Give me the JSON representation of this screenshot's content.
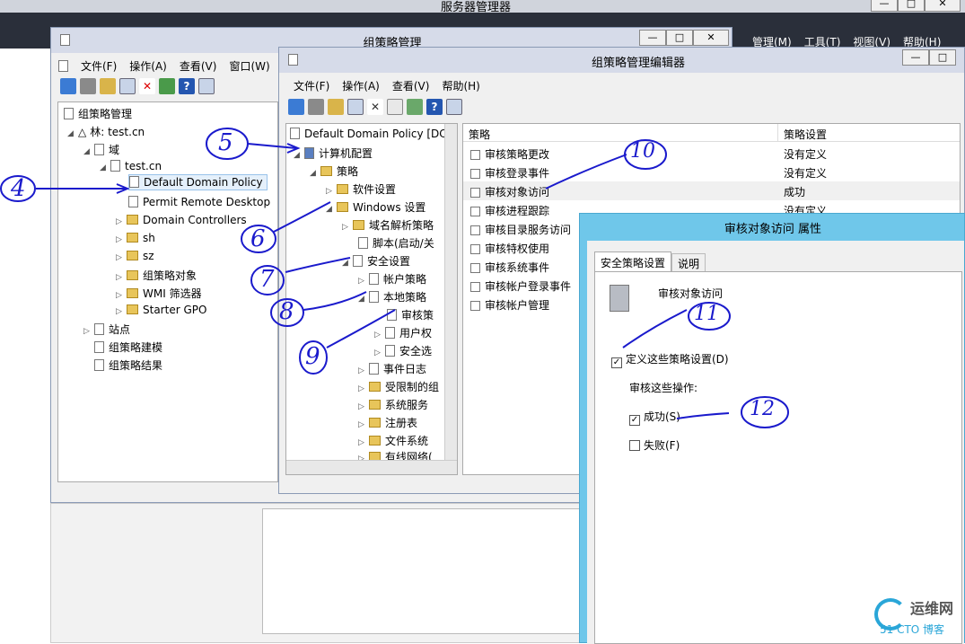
{
  "server_manager": {
    "title": "服务器管理器",
    "menu": [
      "管理(M)",
      "工具(T)",
      "视图(V)",
      "帮助(H)"
    ]
  },
  "gpm": {
    "title": "组策略管理",
    "menu": [
      "文件(F)",
      "操作(A)",
      "查看(V)",
      "窗口(W)"
    ],
    "tree": {
      "root": "组策略管理",
      "forest": "林: test.cn",
      "domains": "域",
      "domain": "test.cn",
      "items": [
        "Default Domain Policy",
        "Permit Remote Desktop",
        "Domain Controllers",
        "sh",
        "sz",
        "组策略对象",
        "WMI 筛选器",
        "Starter GPO"
      ],
      "sites": "站点",
      "modeling": "组策略建模",
      "results": "组策略结果"
    }
  },
  "gpme": {
    "title": "组策略管理编辑器",
    "menu": [
      "文件(F)",
      "操作(A)",
      "查看(V)",
      "帮助(H)"
    ],
    "tree": {
      "root": "Default Domain Policy [DC",
      "computer_config": "计算机配置",
      "policies": "策略",
      "software": "软件设置",
      "windows": "Windows 设置",
      "dns": "域名解析策略",
      "scripts": "脚本(启动/关",
      "security": "安全设置",
      "account": "帐户策略",
      "local": "本地策略",
      "audit": "审核策",
      "user_rights": "用户权",
      "security_options": "安全选",
      "event_log": "事件日志",
      "restricted": "受限制的组",
      "system_services": "系统服务",
      "registry": "注册表",
      "filesystem": "文件系统",
      "wired": "有线网络("
    },
    "list": {
      "col_policy": "策略",
      "col_setting": "策略设置",
      "rows": [
        {
          "name": "审核策略更改",
          "value": "没有定义"
        },
        {
          "name": "审核登录事件",
          "value": "没有定义"
        },
        {
          "name": "审核对象访问",
          "value": "成功"
        },
        {
          "name": "审核进程跟踪",
          "value": "没有定义"
        },
        {
          "name": "审核目录服务访问",
          "value": ""
        },
        {
          "name": "审核特权使用",
          "value": ""
        },
        {
          "name": "审核系统事件",
          "value": ""
        },
        {
          "name": "审核帐户登录事件",
          "value": ""
        },
        {
          "name": "审核帐户管理",
          "value": ""
        }
      ]
    }
  },
  "props": {
    "title": "审核对象访问 属性",
    "tabs": [
      "安全策略设置",
      "说明"
    ],
    "policy_name": "审核对象访问",
    "define_label": "定义这些策略设置(D)",
    "audit_label": "审核这些操作:",
    "success_label": "成功(S)",
    "failure_label": "失败(F)"
  },
  "annotations": [
    "4",
    "5",
    "6",
    "7",
    "8",
    "9",
    "10",
    "11",
    "12"
  ],
  "watermark": {
    "line1": "运维网",
    "line2": "51 CTO 博客"
  }
}
